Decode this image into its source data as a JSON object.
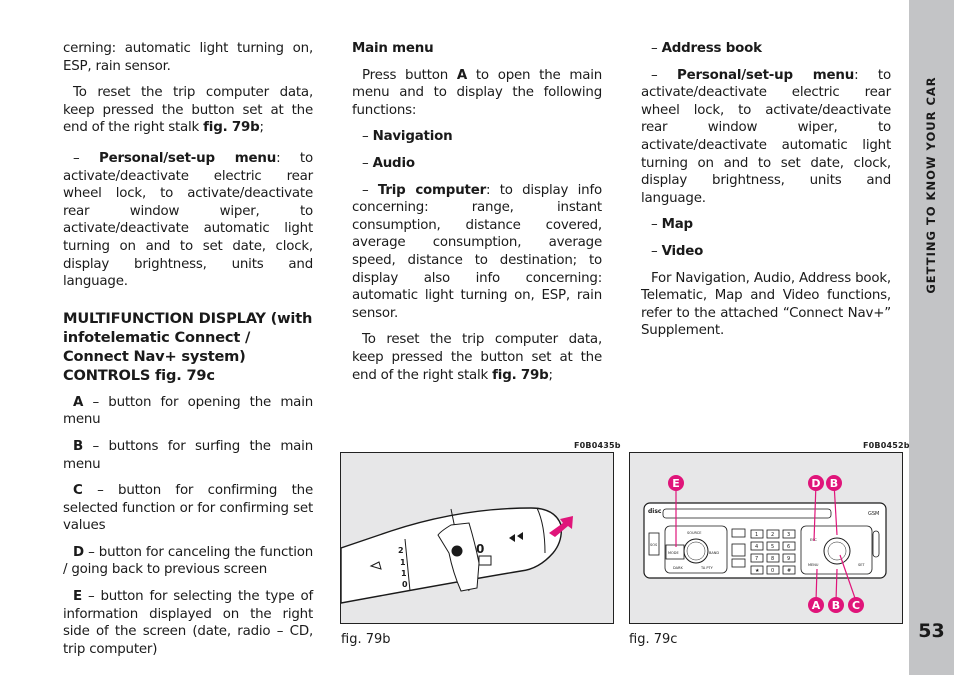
{
  "page": {
    "section_title": "GETTING TO KNOW YOUR CAR",
    "page_number": "53"
  },
  "col1": {
    "p1": "cerning: automatic light turning on, ESP, rain sensor.",
    "p2_text": "To reset the trip computer data, keep pressed the button set at the end of the right stalk ",
    "p2_ref": "fig. 79b",
    "p2_end": ";",
    "p3_dash": "– ",
    "p3_bold": "Personal/set-up menu",
    "p3_text": ": to activate/deactivate electric rear wheel lock, to activate/deactivate rear window wiper, to activate/deactivate automatic light turning on and to set date, clock, display brightness, units and language.",
    "heading": "MULTIFUNCTION DISPLAY (with infotelematic Connect / Connect Nav+ system) CONTROLS fig. 79c",
    "controls": [
      {
        "key": "A",
        "text": " – button for opening the main menu"
      },
      {
        "key": "B",
        "text": " – buttons for surfing the main menu"
      },
      {
        "key": "C",
        "text": " – button for confirming the selected function or for confirming set values"
      },
      {
        "key": "D",
        "text": " – button for canceling the function / going back to previous screen"
      },
      {
        "key": "E",
        "text": " – button for selecting the type of information displayed on the right side of the screen (date, radio – CD, trip computer)"
      }
    ]
  },
  "col2": {
    "heading": "Main menu",
    "intro_pre": "Press button ",
    "intro_key": "A",
    "intro_post": " to open the main menu and to display the following functions:",
    "items": [
      {
        "dash": "– ",
        "label": "Navigation",
        "text": ""
      },
      {
        "dash": "– ",
        "label": "Audio",
        "text": ""
      },
      {
        "dash": "– ",
        "label": "Trip computer",
        "text": ": to display info concerning: range, instant consumption, distance covered, average consumption, average speed, distance to destination; to display also info concerning: automatic light turning on, ESP, rain sensor."
      }
    ],
    "reset_text": "To reset the trip computer data, keep pressed the button set at the end of the right stalk ",
    "reset_ref": "fig. 79b",
    "reset_end": ";"
  },
  "col3": {
    "items": [
      {
        "dash": "– ",
        "label": "Address book",
        "text": ""
      },
      {
        "dash": "– ",
        "label": "Personal/set-up menu",
        "text": ": to activate/deactivate electric rear wheel lock, to activate/deactivate rear window wiper, to activate/deactivate automatic light turning on and to set date, clock, display brightness, units and language."
      },
      {
        "dash": "– ",
        "label": "Map",
        "text": ""
      },
      {
        "dash": "– ",
        "label": "Video",
        "text": ""
      }
    ],
    "footer": "For Navigation, Audio, Address book, Telematic, Map and Video functions, refer to the attached “Connect Nav+” Supplement."
  },
  "figures": {
    "fig79b": {
      "code": "F0B0435b",
      "caption": "fig. 79b",
      "labels": {
        "n2": "2",
        "n1a": "1",
        "n1b": "1",
        "n0": "0",
        "big0": "0"
      }
    },
    "fig79c": {
      "code": "F0B0452b",
      "caption": "fig. 79c",
      "callouts": [
        "E",
        "D",
        "B",
        "A",
        "B",
        "C"
      ],
      "unit_labels": {
        "disc": "disc",
        "gsm": "GSM",
        "sos": "SOS",
        "mode": "MODE",
        "source": "SOURCE",
        "band": "BAND",
        "dark": "DARK",
        "ta_pty": "TA PTY",
        "esc": "ESC",
        "menu": "MENU",
        "set": "SET",
        "keys": [
          "1",
          "2",
          "3",
          "4",
          "5",
          "6",
          "7",
          "8",
          "9",
          "★",
          "0",
          "#"
        ]
      }
    }
  },
  "colors": {
    "accent": "#e0157a",
    "sidebar": "#c3c4c6",
    "figure_bg": "#e7e7e8"
  }
}
